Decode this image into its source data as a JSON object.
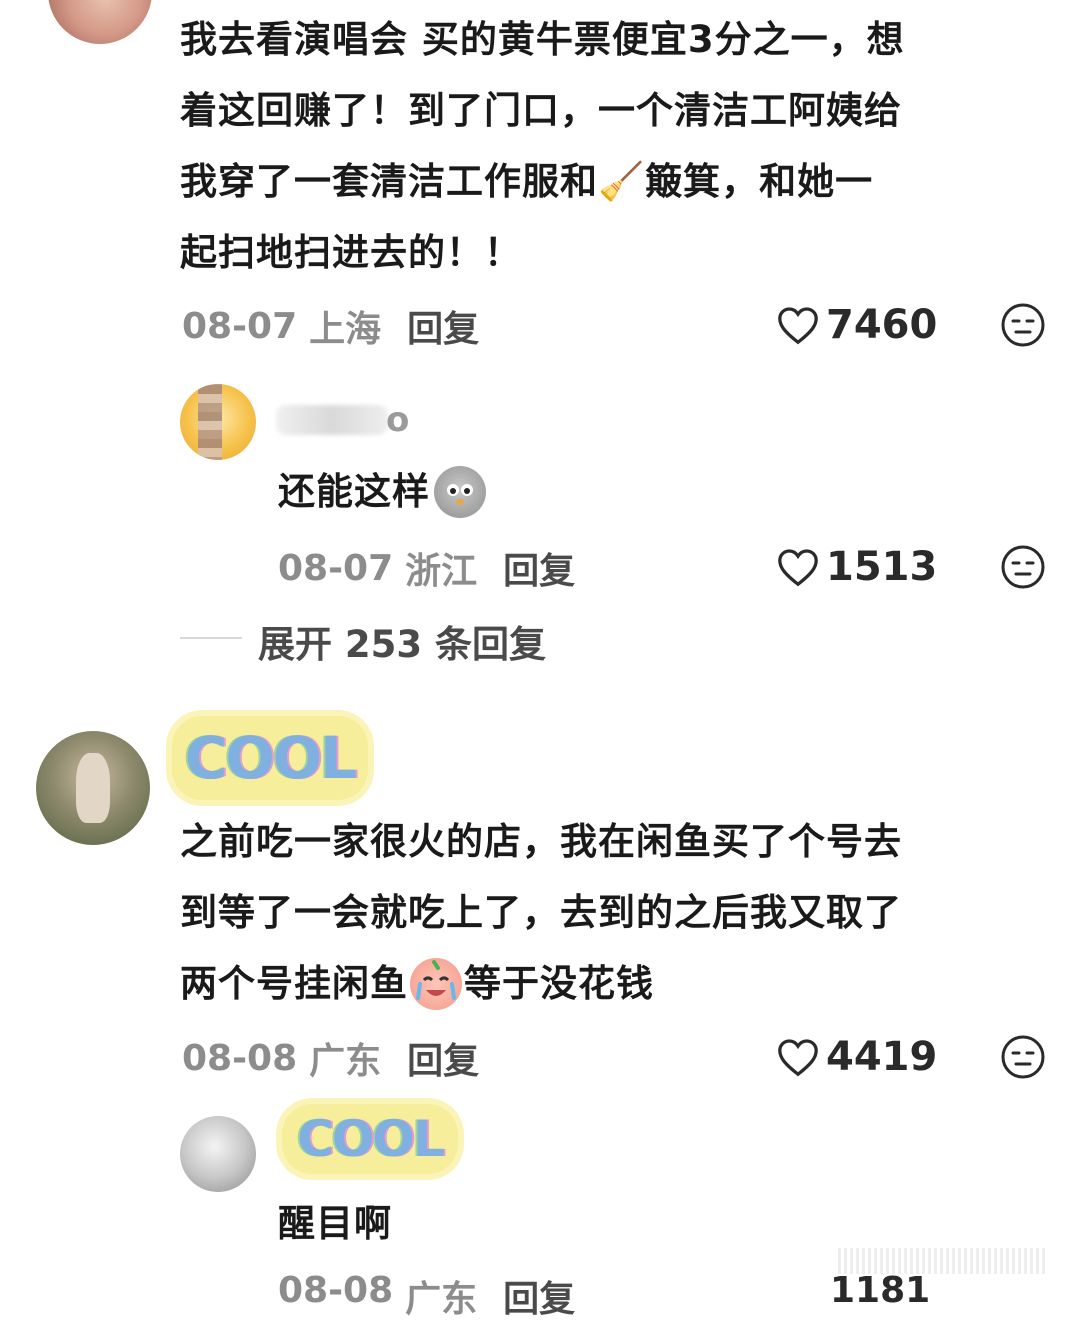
{
  "comments": [
    {
      "text_lines": [
        "我去看演唱会 买的黄牛票便宜3分之一，想",
        "着这回赚了！到了门口，一个清洁工阿姨给",
        "我穿了一套清洁工作服和🧹簸箕，和她一",
        "起扫地扫进去的！！"
      ],
      "date": "08-07",
      "location": "上海",
      "reply_label": "回复",
      "likes": "7460"
    },
    {
      "username_visible": "o",
      "text": "还能这样",
      "date": "08-07",
      "location": "浙江",
      "reply_label": "回复",
      "likes": "1513"
    },
    {
      "expand_label": "展开 253 条回复"
    },
    {
      "badge": "COOL",
      "text_lines": [
        "之前吃一家很火的店，我在闲鱼买了个号去",
        "到等了一会就吃上了，去到的之后我又取了",
        "两个号挂闲鱼",
        "等于没花钱"
      ],
      "date": "08-08",
      "location": "广东",
      "reply_label": "回复",
      "likes": "4419"
    },
    {
      "badge": "COOL",
      "text": "醒目啊",
      "date": "08-08",
      "location": "广东",
      "reply_label": "回复",
      "likes": "1181"
    }
  ],
  "icons": {
    "like": "heart-outline-icon",
    "dislike": "meh-face-icon"
  },
  "colors": {
    "text": "#1a1a1a",
    "meta": "#8c8c8c",
    "reply": "#4a4a4a",
    "badge_bg": "#f6ee9a"
  }
}
